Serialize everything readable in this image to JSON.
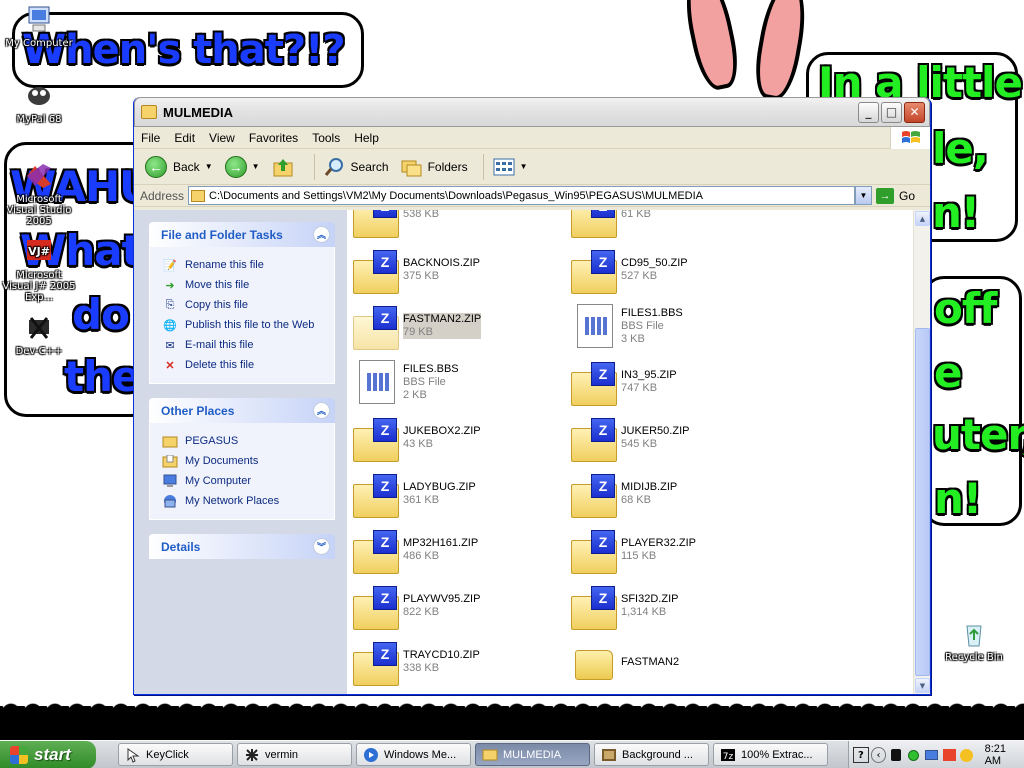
{
  "wallpaper": {
    "bubble_top_left": "When's that?!?",
    "bubble_left_1": "WAHU",
    "bubble_left_2": "What",
    "bubble_left_3": "do",
    "bubble_left_4": "the",
    "bubble_right_1": "In a little",
    "bubble_right_2": "le,",
    "bubble_right_3": "n!",
    "bubble_right_4": "off",
    "bubble_right_5": "e",
    "bubble_right_6": "uter,",
    "bubble_right_7": "n!"
  },
  "desktop_icons": [
    {
      "label": "My Computer",
      "icon": "computer-icon"
    },
    {
      "label": "MyPal 68",
      "icon": "mypal-icon"
    },
    {
      "label": "Microsoft Visual Studio 2005",
      "icon": "visual-studio-icon"
    },
    {
      "label": "Microsoft Visual J# 2005 Exp...",
      "icon": "visual-j-icon"
    },
    {
      "label": "Dev-C++",
      "icon": "devcpp-icon"
    },
    {
      "label": "Recycle Bin",
      "icon": "recycle-bin-icon"
    }
  ],
  "window": {
    "title": "MULMEDIA",
    "menu": [
      "File",
      "Edit",
      "View",
      "Favorites",
      "Tools",
      "Help"
    ],
    "toolbar": {
      "back": "Back",
      "search": "Search",
      "folders": "Folders"
    },
    "address": {
      "label": "Address",
      "path": "C:\\Documents and Settings\\VM2\\My Documents\\Downloads\\Pegasus_Win95\\PEGASUS\\MULMEDIA",
      "go": "Go"
    },
    "task_pane": {
      "file_tasks": {
        "title": "File and Folder Tasks",
        "items": [
          {
            "label": "Rename this file",
            "icon": "rename-icon"
          },
          {
            "label": "Move this file",
            "icon": "move-icon"
          },
          {
            "label": "Copy this file",
            "icon": "copy-icon"
          },
          {
            "label": "Publish this file to the Web",
            "icon": "publish-icon"
          },
          {
            "label": "E-mail this file",
            "icon": "email-icon"
          },
          {
            "label": "Delete this file",
            "icon": "delete-icon"
          }
        ]
      },
      "other_places": {
        "title": "Other Places",
        "items": [
          {
            "label": "PEGASUS",
            "icon": "folder-icon"
          },
          {
            "label": "My Documents",
            "icon": "documents-icon"
          },
          {
            "label": "My Computer",
            "icon": "computer-icon"
          },
          {
            "label": "My Network Places",
            "icon": "network-icon"
          }
        ]
      },
      "details": {
        "title": "Details"
      }
    },
    "files": [
      {
        "name": "",
        "sub1": "538 KB",
        "sub2": "",
        "type": "zip"
      },
      {
        "name": "",
        "sub1": "61 KB",
        "sub2": "",
        "type": "zip"
      },
      {
        "name": "BACKNOIS.ZIP",
        "sub1": "375 KB",
        "sub2": "",
        "type": "zip"
      },
      {
        "name": "CD95_50.ZIP",
        "sub1": "527 KB",
        "sub2": "",
        "type": "zip"
      },
      {
        "name": "FASTMAN2.ZIP",
        "sub1": "79 KB",
        "sub2": "",
        "type": "zip",
        "selected": true
      },
      {
        "name": "FILES1.BBS",
        "sub1": "BBS File",
        "sub2": "3 KB",
        "type": "bbs"
      },
      {
        "name": "FILES.BBS",
        "sub1": "BBS File",
        "sub2": "2 KB",
        "type": "bbs"
      },
      {
        "name": "IN3_95.ZIP",
        "sub1": "747 KB",
        "sub2": "",
        "type": "zip"
      },
      {
        "name": "JUKEBOX2.ZIP",
        "sub1": "43 KB",
        "sub2": "",
        "type": "zip"
      },
      {
        "name": "JUKER50.ZIP",
        "sub1": "545 KB",
        "sub2": "",
        "type": "zip"
      },
      {
        "name": "LADYBUG.ZIP",
        "sub1": "361 KB",
        "sub2": "",
        "type": "zip"
      },
      {
        "name": "MIDIJB.ZIP",
        "sub1": "68 KB",
        "sub2": "",
        "type": "zip"
      },
      {
        "name": "MP32H161.ZIP",
        "sub1": "486 KB",
        "sub2": "",
        "type": "zip"
      },
      {
        "name": "PLAYER32.ZIP",
        "sub1": "115 KB",
        "sub2": "",
        "type": "zip"
      },
      {
        "name": "PLAYWV95.ZIP",
        "sub1": "822 KB",
        "sub2": "",
        "type": "zip"
      },
      {
        "name": "SFI32D.ZIP",
        "sub1": "1,314 KB",
        "sub2": "",
        "type": "zip"
      },
      {
        "name": "TRAYCD10.ZIP",
        "sub1": "338 KB",
        "sub2": "",
        "type": "zip"
      },
      {
        "name": "FASTMAN2",
        "sub1": "",
        "sub2": "",
        "type": "folder"
      }
    ]
  },
  "taskbar": {
    "start": "start",
    "buttons": [
      {
        "label": "KeyClick",
        "icon": "keyclick-icon",
        "active": false
      },
      {
        "label": "vermin",
        "icon": "vermin-icon",
        "active": false
      },
      {
        "label": "Windows Me...",
        "icon": "media-player-icon",
        "active": false
      },
      {
        "label": "MULMEDIA",
        "icon": "folder-icon",
        "active": true
      },
      {
        "label": "Background ...",
        "icon": "background-icon",
        "active": false
      },
      {
        "label": "100% Extrac...",
        "icon": "7zip-icon",
        "active": false
      }
    ],
    "clock": "8:21 AM"
  },
  "colors": {
    "xp_blue": "#0831d9",
    "start_green": "#2f8b27",
    "link_blue": "#0c2a82",
    "wallpaper_blue_text": "#1a3cff",
    "wallpaper_green_text": "#22ee22"
  }
}
